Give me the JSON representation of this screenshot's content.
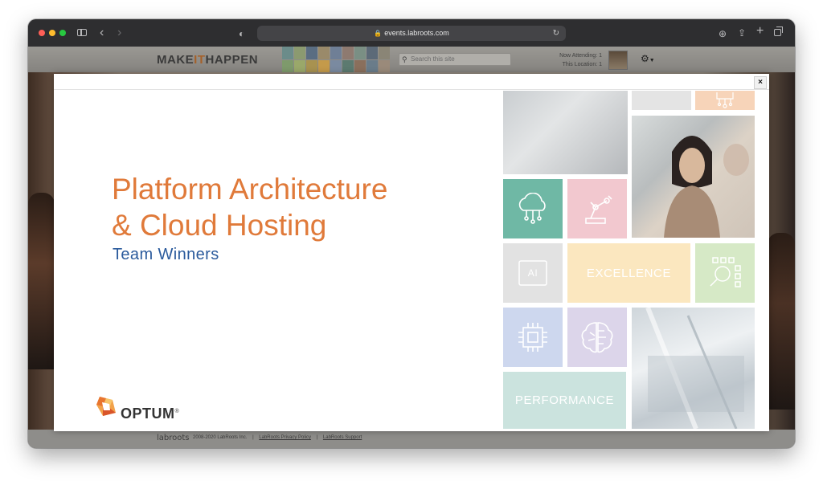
{
  "browser": {
    "url": "events.labroots.com",
    "icons": [
      "sidebar-icon",
      "back-icon",
      "forward-icon",
      "shield-icon",
      "lock-icon",
      "reload-icon",
      "download-icon",
      "share-icon",
      "new-tab-icon",
      "tabs-icon"
    ]
  },
  "page": {
    "header": {
      "brand_make": "MAKE",
      "brand_it": "IT",
      "brand_happen": "HAPPEN",
      "search_placeholder": "Search this site",
      "now_attending": "Now Attending: 1",
      "this_location": "This Location: 1"
    },
    "footer": {
      "brand": "labroots",
      "copyright": "2008-2020 LabRoots Inc.",
      "privacy_link": "LabRoots Privacy Policy",
      "support_link": "LabRoots Support",
      "separator": "|"
    }
  },
  "modal": {
    "close_label": "×",
    "slide": {
      "title_line1": "Platform Architecture",
      "title_line2": "& Cloud Hosting",
      "subtitle": "Team Winners",
      "logo_text": "OPTUM",
      "logo_mark": "®",
      "tiles": {
        "ai": "AI",
        "excellence": "EXCELLENCE",
        "performance": "PERFORMANCE"
      }
    }
  },
  "colors": {
    "title": "#e07a3a",
    "subtitle": "#2a5a9c",
    "tile_cloud": "#6fb8a5",
    "tile_robot": "#f2c8cf",
    "tile_excellence": "#fbe7bf",
    "tile_qr": "#d6e9c6",
    "tile_chip": "#cdd7ee",
    "tile_brain": "#dcd5ea",
    "tile_performance": "#cbe3de"
  }
}
